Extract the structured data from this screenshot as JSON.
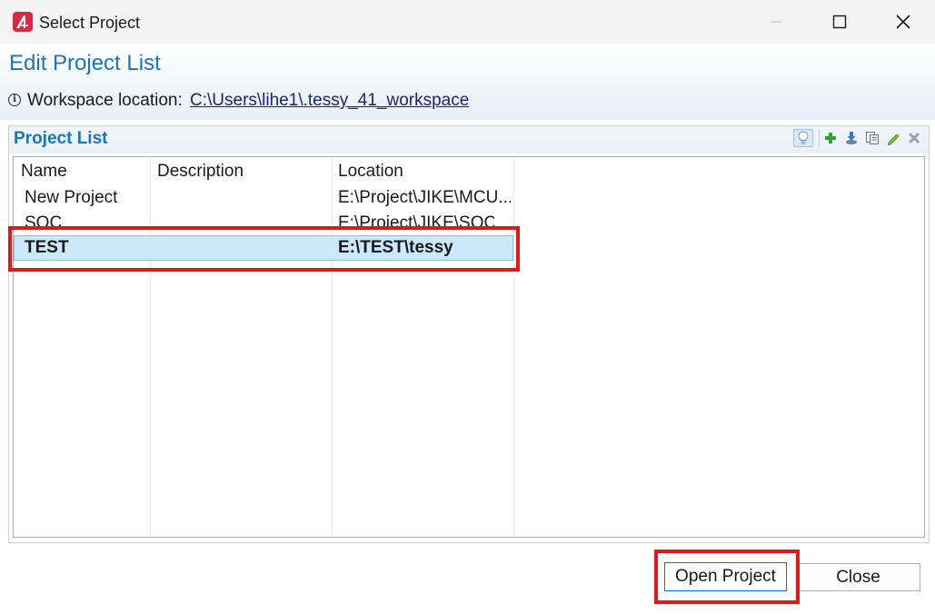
{
  "window": {
    "title": "Select Project",
    "controls": {
      "minimize": "minimize-icon",
      "maximize": "maximize-icon",
      "close": "close-icon"
    }
  },
  "header": {
    "title": "Edit Project List",
    "workspace_label": "Workspace location:",
    "workspace_path": "C:\\Users\\lihe1\\.tessy_41_workspace"
  },
  "project_list": {
    "title": "Project List",
    "toolbar": [
      "lightbulb-icon",
      "add-icon",
      "import-icon",
      "copy-icon",
      "edit-icon",
      "delete-icon"
    ],
    "columns": [
      "Name",
      "Description",
      "Location"
    ],
    "rows": [
      {
        "name": "New Project",
        "description": "",
        "location": "E:\\Project\\JIKE\\MCU..."
      },
      {
        "name": "SOC",
        "description": "",
        "location": "E:\\Project\\JIKE\\SOC\\..."
      },
      {
        "name": "TEST",
        "description": "",
        "location": "E:\\TEST\\tessy",
        "selected": true
      }
    ]
  },
  "buttons": {
    "open": "Open Project",
    "close": "Close"
  },
  "colors": {
    "accent": "#1a75bb",
    "selection": "#cce8fb",
    "annotation": "#e01818",
    "link": "#1a237e"
  }
}
